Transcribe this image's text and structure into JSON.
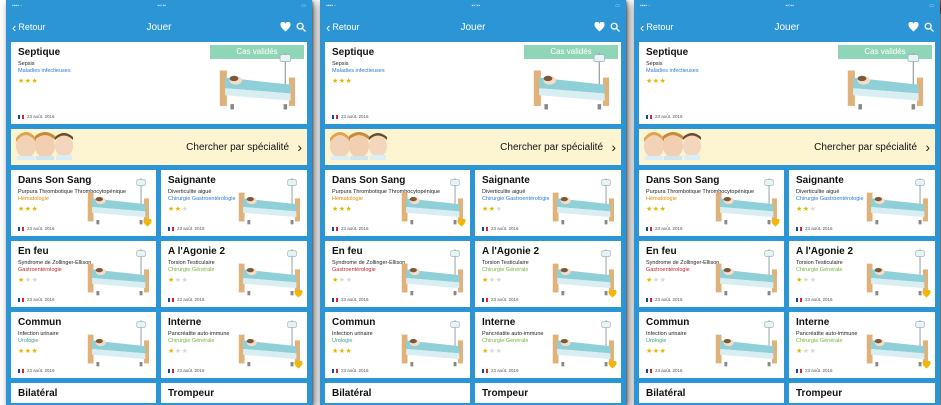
{
  "nav": {
    "back_label": "Retour",
    "title": "Jouer",
    "icons": [
      "heart-icon",
      "search-icon"
    ]
  },
  "colors": {
    "background": "#2b95d6",
    "ribbon": "#8fd6b9",
    "specialty_bg": "#fdf4d2",
    "star": "#e8b400",
    "spec_blue": "#2a7ad8",
    "spec_orange": "#e58a00",
    "spec_red": "#c2242b",
    "spec_green": "#6fb83a",
    "spec_teal": "#3aa58b"
  },
  "featured": {
    "ribbon": "Cas validés",
    "title": "Septique",
    "subtitle": "Sepsis",
    "specialty": "Maladies infectieuses",
    "stars": 3,
    "date": "23 août. 2016"
  },
  "specialty_banner": {
    "label": "Chercher par spécialité",
    "chevron": "›"
  },
  "cases": [
    {
      "title": "Dans Son Sang",
      "subtitle": "Purpura Thrombotique Thrombocytopénique",
      "specialty": "Hématologie",
      "spec_color": "#e58a00",
      "stars": 3,
      "date": "23 août. 2016",
      "favorite": true
    },
    {
      "title": "Saignante",
      "subtitle": "Diverticulite aiguë",
      "specialty": "Chirurgie Gastroentérologie",
      "spec_color": "#2a7ad8",
      "stars": 2,
      "date": "23 août. 2016",
      "favorite": false
    },
    {
      "title": "En feu",
      "subtitle": "Syndrome de Zollinger-Ellison",
      "specialty": "Gastroentérologie",
      "spec_color": "#c2242b",
      "stars": 1,
      "date": "23 août. 2016",
      "favorite": false
    },
    {
      "title": "A l'Agonie 2",
      "subtitle": "Torsion Testiculaire",
      "specialty": "Chirurgie Générale",
      "spec_color": "#6fb83a",
      "stars": 1,
      "date": "23 août. 2016",
      "favorite": true
    },
    {
      "title": "Commun",
      "subtitle": "Infection urinaire",
      "specialty": "Urologie",
      "spec_color": "#3aa58b",
      "stars": 3,
      "date": "23 août. 2016",
      "favorite": false
    },
    {
      "title": "Interne",
      "subtitle": "Pancréatite auto-immune",
      "specialty": "Chirurgie Générale",
      "spec_color": "#6fb83a",
      "stars": 1,
      "date": "23 août. 2016",
      "favorite": true
    },
    {
      "title": "Bilatéral",
      "subtitle": "",
      "specialty": "",
      "spec_color": "#3aa58b",
      "stars": 0,
      "date": "",
      "favorite": false
    },
    {
      "title": "Trompeur",
      "subtitle": "",
      "specialty": "",
      "spec_color": "#3aa58b",
      "stars": 0,
      "date": "",
      "favorite": false
    }
  ]
}
